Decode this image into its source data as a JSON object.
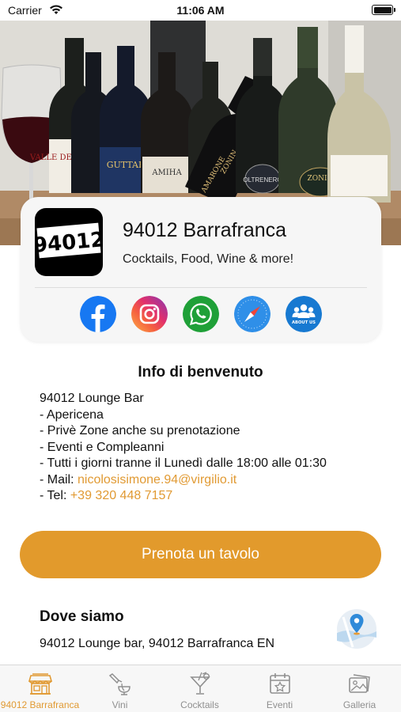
{
  "status_bar": {
    "carrier": "Carrier",
    "time": "11:06 AM"
  },
  "colors": {
    "accent": "#e29a2c",
    "link": "#e19a33",
    "inactive_tab": "#8f8f8f"
  },
  "profile": {
    "logo_text": "94012",
    "name": "94012 Barrafranca",
    "tagline": "Cocktails, Food, Wine & more!",
    "social_links": [
      {
        "icon": "facebook-icon"
      },
      {
        "icon": "instagram-icon"
      },
      {
        "icon": "whatsapp-icon"
      },
      {
        "icon": "safari-compass-icon"
      },
      {
        "icon": "about-us-icon",
        "label": "ABOUT US"
      }
    ]
  },
  "info": {
    "title": "Info di benvenuto",
    "lines": [
      "94012 Lounge Bar",
      "- Apericena",
      "- Privè Zone anche su prenotazione",
      "- Eventi e Compleanni",
      "- Tutti i giorni tranne il Lunedì dalle 18:00 alle 01:30"
    ],
    "mail_prefix": "- Mail: ",
    "mail": "nicolosisimone.94@virgilio.it",
    "tel_prefix": "- Tel: ",
    "tel": "+39 320 448 7157"
  },
  "book_button": "Prenota un tavolo",
  "location": {
    "title": "Dove siamo",
    "address": "94012 Lounge bar, 94012 Barrafranca EN",
    "icon": "map-pin-icon"
  },
  "hero_labels": {
    "bottle_1": "VALLE DELLE PERLE",
    "bottle_2": "GUTTAR",
    "bottle_3": "AMIHA",
    "bottle_4_brand": "ZONIN",
    "bottle_4_name": "AMARONE",
    "bottle_5": "OLTRENERO",
    "bottle_6": "ZONIN"
  },
  "tabs": [
    {
      "label": "94012 Barrafranca",
      "icon": "storefront-icon",
      "active": true
    },
    {
      "label": "Vini",
      "icon": "wine-pour-icon",
      "active": false
    },
    {
      "label": "Cocktails",
      "icon": "cocktail-icon",
      "active": false
    },
    {
      "label": "Eventi",
      "icon": "calendar-star-icon",
      "active": false
    },
    {
      "label": "Galleria",
      "icon": "gallery-icon",
      "active": false
    }
  ]
}
